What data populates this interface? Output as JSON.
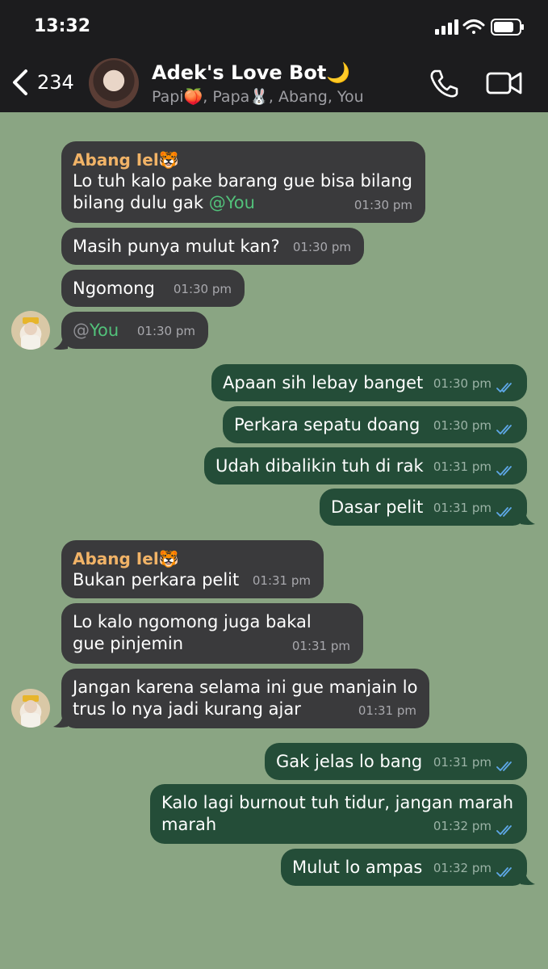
{
  "status": {
    "time": "13:32"
  },
  "header": {
    "back_count": "234",
    "title": "Adek's Love Bot🌙",
    "subtitle": "Papi🍑, Papa🐰, Abang, You"
  },
  "messages": [
    {
      "dir": "in",
      "sender": "Abang Iel🐯",
      "text": "Lo tuh kalo pake barang gue bisa bilang bilang dulu gak ",
      "mention": "@You",
      "time": "01:30 pm"
    },
    {
      "dir": "in",
      "text": "Masih punya mulut kan?",
      "time": "01:30 pm"
    },
    {
      "dir": "in",
      "text": "Ngomong",
      "time": "01:30 pm"
    },
    {
      "dir": "in",
      "at": "@",
      "mention": "You",
      "time": "01:30 pm"
    },
    {
      "dir": "out",
      "text": "Apaan sih lebay banget",
      "time": "01:30 pm"
    },
    {
      "dir": "out",
      "text": "Perkara sepatu doang",
      "time": "01:30 pm"
    },
    {
      "dir": "out",
      "text": "Udah dibalikin tuh di rak",
      "time": "01:31 pm"
    },
    {
      "dir": "out",
      "text": "Dasar pelit",
      "time": "01:31 pm"
    },
    {
      "dir": "in",
      "sender": "Abang Iel🐯",
      "text": "Bukan perkara pelit",
      "time": "01:31 pm"
    },
    {
      "dir": "in",
      "text": "Lo kalo ngomong juga bakal gue pinjemin",
      "time": "01:31 pm"
    },
    {
      "dir": "in",
      "text": "Jangan karena selama ini gue manjain lo trus lo nya jadi kurang ajar",
      "time": "01:31 pm"
    },
    {
      "dir": "out",
      "text": "Gak jelas lo bang",
      "time": "01:31 pm"
    },
    {
      "dir": "out",
      "text": "Kalo lagi burnout tuh tidur, jangan marah marah",
      "time": "01:32 pm"
    },
    {
      "dir": "out",
      "text": "Mulut lo ampas",
      "time": "01:32 pm"
    }
  ],
  "colors": {
    "background": "#8aa583",
    "incoming_bubble": "#3a3a3c",
    "outgoing_bubble": "#244d38",
    "sender_name": "#f1b367",
    "mention": "#52c17a",
    "read_ticks": "#5ea8e8"
  },
  "icons": [
    "back-chevron-icon",
    "phone-icon",
    "video-camera-icon",
    "signal-icon",
    "wifi-icon",
    "battery-icon",
    "double-check-icon"
  ]
}
